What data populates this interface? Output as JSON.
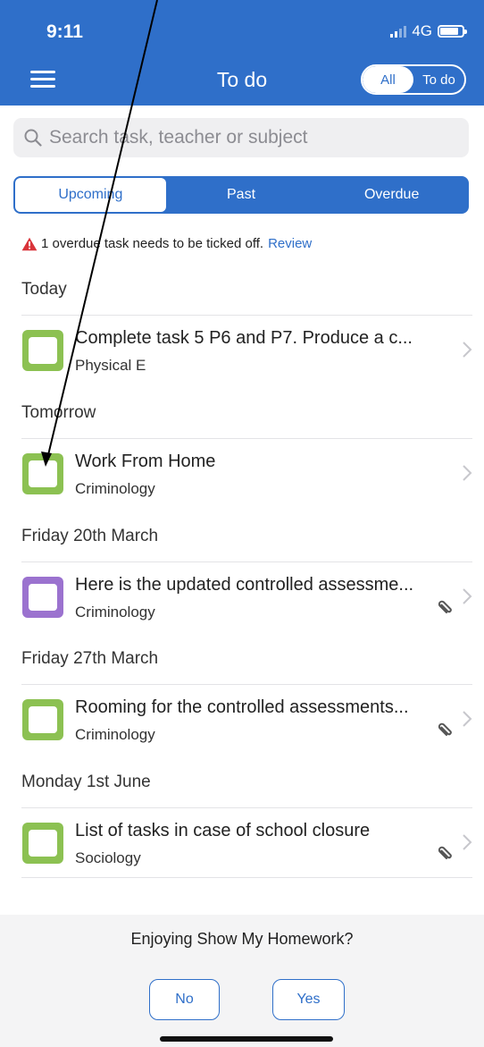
{
  "status_bar": {
    "time": "9:11",
    "network": "4G"
  },
  "header": {
    "title": "To do",
    "filter_toggle": {
      "options": [
        "All",
        "To do"
      ],
      "selected": "All"
    }
  },
  "search": {
    "placeholder": "Search task, teacher or subject"
  },
  "segments": {
    "options": [
      "Upcoming",
      "Past",
      "Overdue"
    ],
    "selected": "Upcoming"
  },
  "alert": {
    "text": "1 overdue task needs to be ticked off.",
    "link": "Review"
  },
  "sections": [
    {
      "title": "Today",
      "tasks": [
        {
          "title": "Complete task 5 P6 and P7. Produce a c...",
          "subject": "Physical E",
          "color": "#8cc152",
          "attachment": false
        }
      ]
    },
    {
      "title": "Tomorrow",
      "tasks": [
        {
          "title": "Work From Home",
          "subject": "Criminology",
          "color": "#8cc152",
          "attachment": false
        }
      ]
    },
    {
      "title": "Friday 20th March",
      "tasks": [
        {
          "title": "Here is the updated controlled assessme...",
          "subject": "Criminology",
          "color": "#9b72cf",
          "attachment": true
        }
      ]
    },
    {
      "title": "Friday 27th March",
      "tasks": [
        {
          "title": "Rooming for the controlled assessments...",
          "subject": "Criminology",
          "color": "#8cc152",
          "attachment": true
        }
      ]
    },
    {
      "title": "Monday 1st June",
      "tasks": [
        {
          "title": "List of tasks in case of school closure",
          "subject": "Sociology",
          "color": "#8cc152",
          "attachment": true
        }
      ]
    }
  ],
  "rating_prompt": {
    "question": "Enjoying Show My Homework?",
    "no_label": "No",
    "yes_label": "Yes"
  },
  "colors": {
    "brand": "#2f6fc9",
    "warning": "#d9343a"
  }
}
